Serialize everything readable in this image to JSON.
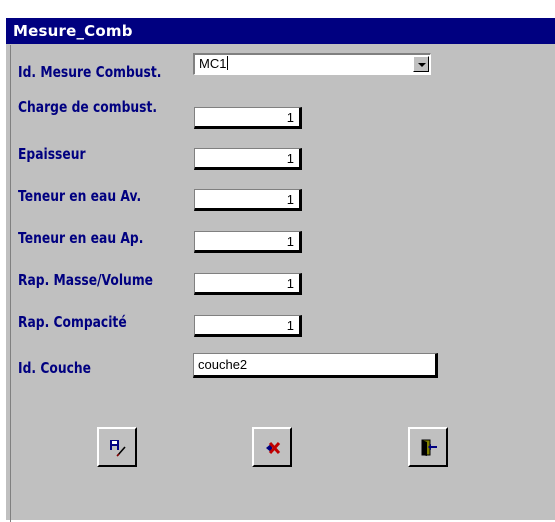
{
  "window": {
    "title": "Mesure_Comb"
  },
  "form": {
    "id_mesure_label": "Id. Mesure Combust.",
    "id_mesure_value": "MC1",
    "fields": [
      {
        "label": "Charge de combust.",
        "value": "1"
      },
      {
        "label": "Epaisseur",
        "value": "1"
      },
      {
        "label": "Teneur en eau Av.",
        "value": "1"
      },
      {
        "label": "Teneur en eau Ap.",
        "value": "1"
      },
      {
        "label": "Rap. Masse/Volume",
        "value": "1"
      },
      {
        "label": "Rap. Compacité",
        "value": "1"
      }
    ],
    "id_couche_label": "Id. Couche",
    "id_couche_value": "couche2"
  },
  "toolbar": {
    "buttons": [
      {
        "icon": "save-edit-icon"
      },
      {
        "icon": "delete-icon"
      },
      {
        "icon": "exit-door-icon"
      }
    ]
  },
  "colors": {
    "label": "#000080",
    "titlebar": "#000080",
    "form_bg": "#c0c0c0",
    "delete_icon": "#c00000"
  }
}
